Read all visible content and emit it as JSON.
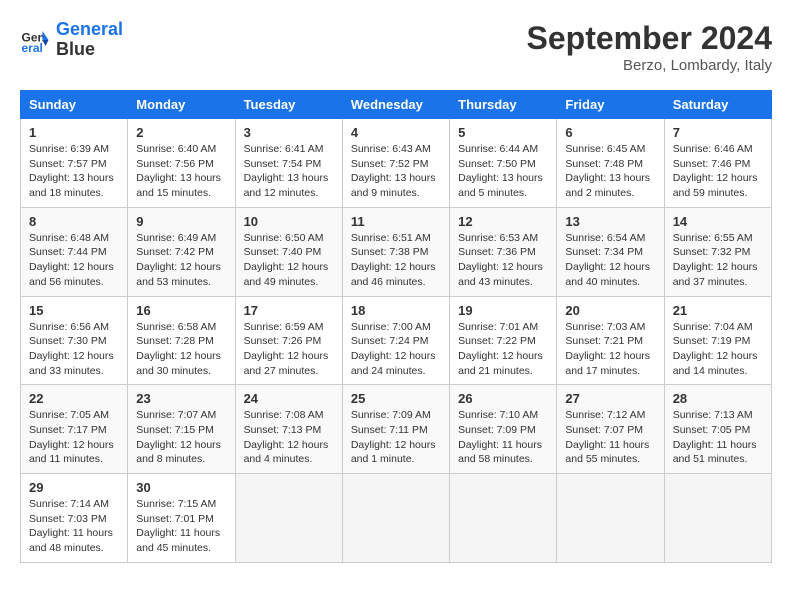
{
  "header": {
    "logo_line1": "General",
    "logo_line2": "Blue",
    "month_title": "September 2024",
    "subtitle": "Berzo, Lombardy, Italy"
  },
  "days_of_week": [
    "Sunday",
    "Monday",
    "Tuesday",
    "Wednesday",
    "Thursday",
    "Friday",
    "Saturday"
  ],
  "weeks": [
    [
      {
        "day": "1",
        "rise": "6:39 AM",
        "set": "7:57 PM",
        "daylight": "13 hours and 18 minutes."
      },
      {
        "day": "2",
        "rise": "6:40 AM",
        "set": "7:56 PM",
        "daylight": "13 hours and 15 minutes."
      },
      {
        "day": "3",
        "rise": "6:41 AM",
        "set": "7:54 PM",
        "daylight": "13 hours and 12 minutes."
      },
      {
        "day": "4",
        "rise": "6:43 AM",
        "set": "7:52 PM",
        "daylight": "13 hours and 9 minutes."
      },
      {
        "day": "5",
        "rise": "6:44 AM",
        "set": "7:50 PM",
        "daylight": "13 hours and 5 minutes."
      },
      {
        "day": "6",
        "rise": "6:45 AM",
        "set": "7:48 PM",
        "daylight": "13 hours and 2 minutes."
      },
      {
        "day": "7",
        "rise": "6:46 AM",
        "set": "7:46 PM",
        "daylight": "12 hours and 59 minutes."
      }
    ],
    [
      {
        "day": "8",
        "rise": "6:48 AM",
        "set": "7:44 PM",
        "daylight": "12 hours and 56 minutes."
      },
      {
        "day": "9",
        "rise": "6:49 AM",
        "set": "7:42 PM",
        "daylight": "12 hours and 53 minutes."
      },
      {
        "day": "10",
        "rise": "6:50 AM",
        "set": "7:40 PM",
        "daylight": "12 hours and 49 minutes."
      },
      {
        "day": "11",
        "rise": "6:51 AM",
        "set": "7:38 PM",
        "daylight": "12 hours and 46 minutes."
      },
      {
        "day": "12",
        "rise": "6:53 AM",
        "set": "7:36 PM",
        "daylight": "12 hours and 43 minutes."
      },
      {
        "day": "13",
        "rise": "6:54 AM",
        "set": "7:34 PM",
        "daylight": "12 hours and 40 minutes."
      },
      {
        "day": "14",
        "rise": "6:55 AM",
        "set": "7:32 PM",
        "daylight": "12 hours and 37 minutes."
      }
    ],
    [
      {
        "day": "15",
        "rise": "6:56 AM",
        "set": "7:30 PM",
        "daylight": "12 hours and 33 minutes."
      },
      {
        "day": "16",
        "rise": "6:58 AM",
        "set": "7:28 PM",
        "daylight": "12 hours and 30 minutes."
      },
      {
        "day": "17",
        "rise": "6:59 AM",
        "set": "7:26 PM",
        "daylight": "12 hours and 27 minutes."
      },
      {
        "day": "18",
        "rise": "7:00 AM",
        "set": "7:24 PM",
        "daylight": "12 hours and 24 minutes."
      },
      {
        "day": "19",
        "rise": "7:01 AM",
        "set": "7:22 PM",
        "daylight": "12 hours and 21 minutes."
      },
      {
        "day": "20",
        "rise": "7:03 AM",
        "set": "7:21 PM",
        "daylight": "12 hours and 17 minutes."
      },
      {
        "day": "21",
        "rise": "7:04 AM",
        "set": "7:19 PM",
        "daylight": "12 hours and 14 minutes."
      }
    ],
    [
      {
        "day": "22",
        "rise": "7:05 AM",
        "set": "7:17 PM",
        "daylight": "12 hours and 11 minutes."
      },
      {
        "day": "23",
        "rise": "7:07 AM",
        "set": "7:15 PM",
        "daylight": "12 hours and 8 minutes."
      },
      {
        "day": "24",
        "rise": "7:08 AM",
        "set": "7:13 PM",
        "daylight": "12 hours and 4 minutes."
      },
      {
        "day": "25",
        "rise": "7:09 AM",
        "set": "7:11 PM",
        "daylight": "12 hours and 1 minute."
      },
      {
        "day": "26",
        "rise": "7:10 AM",
        "set": "7:09 PM",
        "daylight": "11 hours and 58 minutes."
      },
      {
        "day": "27",
        "rise": "7:12 AM",
        "set": "7:07 PM",
        "daylight": "11 hours and 55 minutes."
      },
      {
        "day": "28",
        "rise": "7:13 AM",
        "set": "7:05 PM",
        "daylight": "11 hours and 51 minutes."
      }
    ],
    [
      {
        "day": "29",
        "rise": "7:14 AM",
        "set": "7:03 PM",
        "daylight": "11 hours and 48 minutes."
      },
      {
        "day": "30",
        "rise": "7:15 AM",
        "set": "7:01 PM",
        "daylight": "11 hours and 45 minutes."
      },
      null,
      null,
      null,
      null,
      null
    ]
  ],
  "labels": {
    "sunrise": "Sunrise:",
    "sunset": "Sunset:",
    "daylight": "Daylight:"
  }
}
